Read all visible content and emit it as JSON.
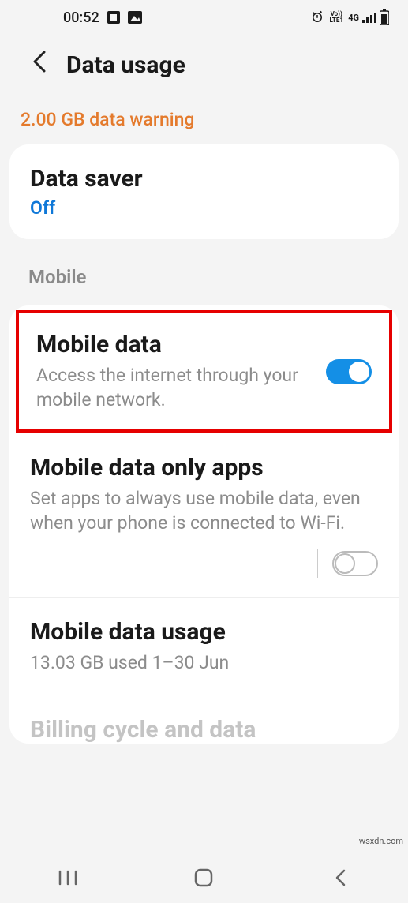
{
  "status": {
    "time": "00:52",
    "network_label": "4G",
    "volte_label": "Vo)) LTE1"
  },
  "header": {
    "title": "Data usage"
  },
  "warning": "2.00 GB data warning",
  "data_saver": {
    "title": "Data saver",
    "status": "Off"
  },
  "section_mobile": "Mobile",
  "mobile_data": {
    "title": "Mobile data",
    "description": "Access the internet through your mobile network.",
    "enabled": true
  },
  "mobile_data_only_apps": {
    "title": "Mobile data only apps",
    "description": "Set apps to always use mobile data, even when your phone is connected to Wi-Fi.",
    "enabled": false
  },
  "mobile_data_usage": {
    "title": "Mobile data usage",
    "summary": "13.03 GB used 1–30 Jun"
  },
  "peek_next": "Billing cycle and data",
  "watermark": "wsxdn.com"
}
